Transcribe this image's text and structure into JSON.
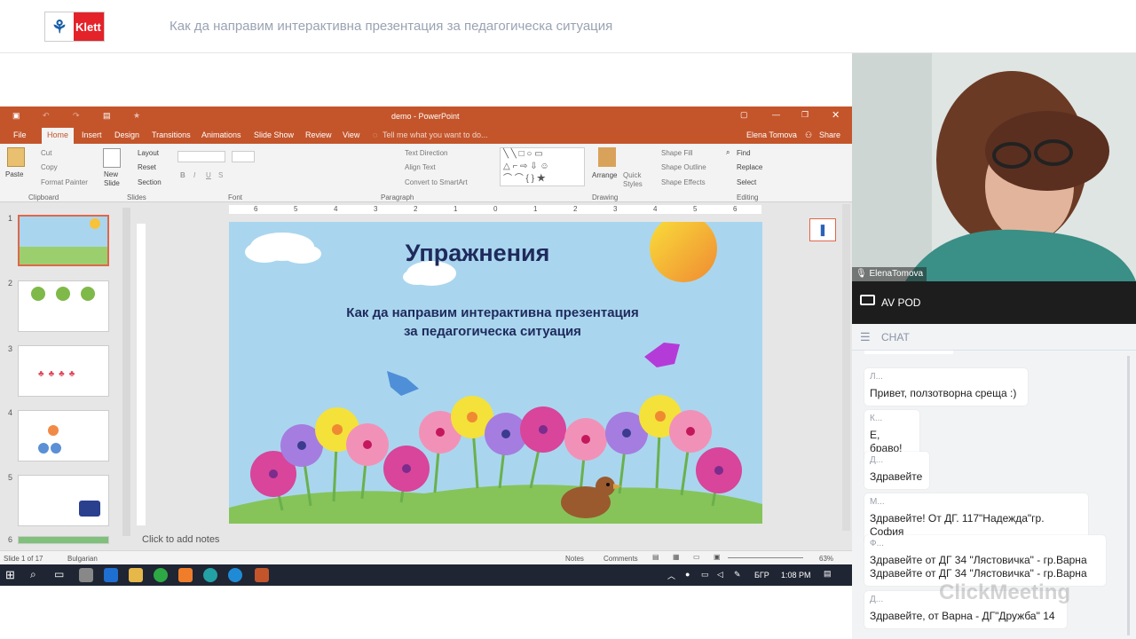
{
  "brand": {
    "logo_text": "Klett"
  },
  "page_title": "Как да направим интерактивна презентация за педагогическа ситуация",
  "ppt": {
    "window_title": "demo - PowerPoint",
    "tabs": [
      "File",
      "Home",
      "Insert",
      "Design",
      "Transitions",
      "Animations",
      "Slide Show",
      "Review",
      "View"
    ],
    "tell_me": "Tell me what you want to do...",
    "user": "Elena Tomova",
    "share": "Share",
    "ribbon": {
      "paste": "Paste",
      "cut": "Cut",
      "copy": "Copy",
      "format_painter": "Format Painter",
      "clipboard": "Clipboard",
      "new_slide": "New Slide",
      "layout": "Layout",
      "reset": "Reset",
      "section": "Section",
      "slides": "Slides",
      "font": "Font",
      "text_direction": "Text Direction",
      "align_text": "Align Text",
      "convert_smartart": "Convert to SmartArt",
      "paragraph": "Paragraph",
      "arrange": "Arrange",
      "quick_styles": "Quick Styles",
      "shape_fill": "Shape Fill",
      "shape_outline": "Shape Outline",
      "shape_effects": "Shape Effects",
      "drawing": "Drawing",
      "find": "Find",
      "replace": "Replace",
      "select": "Select",
      "editing": "Editing"
    },
    "ruler": [
      "6",
      "5",
      "4",
      "3",
      "2",
      "1",
      "0",
      "1",
      "2",
      "3",
      "4",
      "5",
      "6"
    ],
    "slide_numbers": [
      "1",
      "2",
      "3",
      "4",
      "5",
      "6"
    ],
    "slide": {
      "title": "Упражнения",
      "subtitle_line1": "Как да направим интерактивна презентация",
      "subtitle_line2": "за педагогическа ситуация"
    },
    "notes_placeholder": "Click to add notes",
    "status": {
      "slide_count": "Slide 1 of 17",
      "language": "Bulgarian",
      "notes": "Notes",
      "comments": "Comments",
      "zoom": "63%"
    },
    "taskbar": {
      "lang": "БГР",
      "time": "1:08 PM"
    }
  },
  "video": {
    "presenter_name": "ElenaTomova"
  },
  "av_pod": {
    "label": "AV POD"
  },
  "chat": {
    "label": "CHAT",
    "messages": [
      {
        "author": "Л...",
        "lines": [
          "Привет, ползотворна среща :)"
        ]
      },
      {
        "author": "К...",
        "lines": [
          "Е, браво!"
        ]
      },
      {
        "author": "Д...",
        "lines": [
          "Здравейте"
        ]
      },
      {
        "author": "М...",
        "lines": [
          "Здравейте! От ДГ. 117\"Надежда\"гр. София"
        ]
      },
      {
        "author": "Ф...",
        "lines": [
          "Здравейте от ДГ 34 \"Лястовичка\" - гр.Варна",
          "Здравейте от ДГ 34 \"Лястовичка\" - гр.Варна"
        ]
      },
      {
        "author": "Д...",
        "lines": [
          "Здравейте, от Варна - ДГ\"Дружба\" 14"
        ]
      }
    ]
  },
  "watermark": "ClickMeeting",
  "colors": {
    "ppt_accent": "#c4552b",
    "slide_bg": "#a9d6ee",
    "title_color": "#1f2a5c"
  }
}
